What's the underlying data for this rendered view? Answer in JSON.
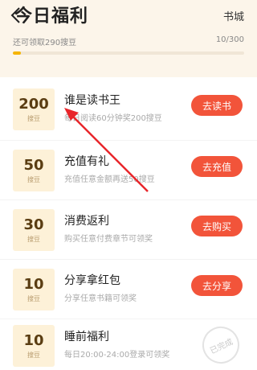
{
  "header": {
    "title": "今日福利",
    "store_link": "书城",
    "progress_text": "还可领取290搜豆",
    "progress_count": "10/300",
    "progress_fraction": 0.033
  },
  "tasks": [
    {
      "amount": "200",
      "unit": "搜豆",
      "name": "谁是读书王",
      "desc": "每日阅读60分钟奖200搜豆",
      "button": "去读书"
    },
    {
      "amount": "50",
      "unit": "搜豆",
      "name": "充值有礼",
      "desc": "充值任意金额再送50搜豆",
      "button": "去充值"
    },
    {
      "amount": "30",
      "unit": "搜豆",
      "name": "消费返利",
      "desc": "购买任意付费章节可领奖",
      "button": "去购买"
    },
    {
      "amount": "10",
      "unit": "搜豆",
      "name": "分享拿红包",
      "desc": "分享任意书籍可领奖",
      "button": "去分享"
    },
    {
      "amount": "10",
      "unit": "搜豆",
      "name": "睡前福利",
      "desc": "每日20:00-24:00登录可领奖",
      "done_label": "已完成"
    }
  ],
  "colors": {
    "header_bg": "#fcf5ea",
    "accent_button": "#f2543a",
    "progress_fill": "#f5b400",
    "annotation_arrow": "#e8262b"
  },
  "icons": {
    "back": "chevron-left-icon"
  }
}
